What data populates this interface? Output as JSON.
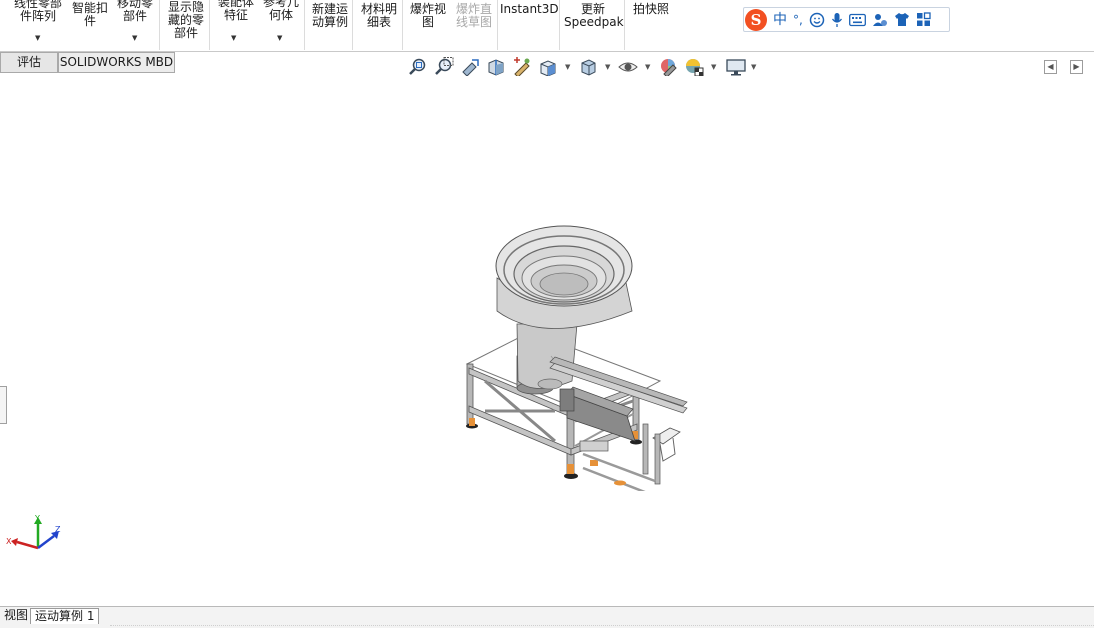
{
  "ribbon": {
    "items": [
      {
        "label": "线性零部\n件阵列",
        "has_arrow": true
      },
      {
        "label": "智能扣\n件",
        "has_arrow": false
      },
      {
        "label": "移动零\n部件",
        "has_arrow": true
      },
      {
        "label": "显示隐\n藏的零\n部件",
        "has_arrow": false
      },
      {
        "label": "装配体\n特征",
        "has_arrow": true
      },
      {
        "label": "参考几\n何体",
        "has_arrow": true
      },
      {
        "label": "新建运\n动算例",
        "has_arrow": false
      },
      {
        "label": "材料明\n细表",
        "has_arrow": false
      },
      {
        "label": "爆炸视\n图",
        "has_arrow": false
      },
      {
        "label": "爆炸直\n线草图",
        "disabled": true
      },
      {
        "label": "Instant3D",
        "has_arrow": false
      },
      {
        "label": "更新\nSpeedpak",
        "has_arrow": false
      },
      {
        "label": "拍快照",
        "has_arrow": false
      }
    ]
  },
  "ime": {
    "mode": "中",
    "punct": "°,",
    "icons": [
      "emoji-icon",
      "microphone-icon",
      "keyboard-icon",
      "user-tools-icon",
      "skin-shirt-icon",
      "apps-grid-icon"
    ]
  },
  "tabs": {
    "evaluate": "评估",
    "mbd": "SOLIDWORKS MBD"
  },
  "hud": {
    "icons": [
      "zoom-to-fit-icon",
      "zoom-to-area-icon",
      "previous-view-icon",
      "section-view-icon",
      "dynamic-annotation-icon",
      "view-orientation-icon",
      "display-style-icon",
      "hide-show-items-icon",
      "edit-appearance-icon",
      "apply-scene-icon",
      "view-settings-icon"
    ]
  },
  "triad": {
    "x": "X",
    "y": "Y",
    "z": "Z"
  },
  "bottom_tabs": {
    "model": "视图",
    "motion": "运动算例 1"
  },
  "colors": {
    "ribbon_bg": "#ffffff",
    "tab_bg": "#e6e6e6",
    "ime_accent": "#1c63b7",
    "ime_logo": "#f25022",
    "triad_x": "#cc2222",
    "triad_y": "#22aa22",
    "triad_z": "#2244cc"
  }
}
